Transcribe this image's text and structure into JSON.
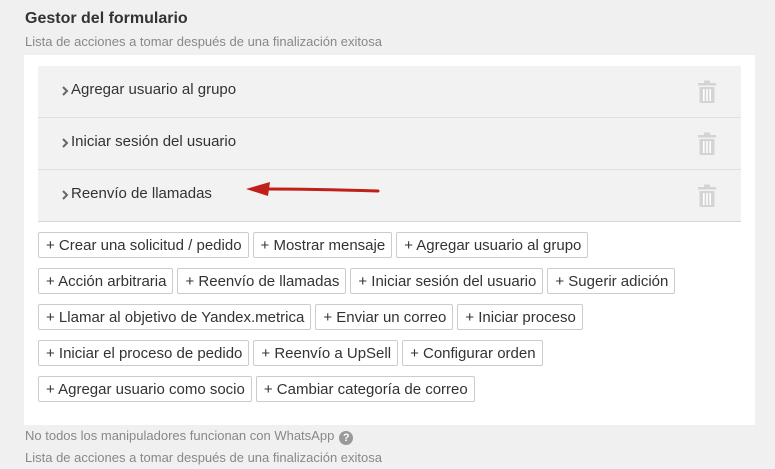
{
  "header": {
    "title": "Gestor del formulario",
    "subtitle": "Lista de acciones a tomar después de una finalización exitosa"
  },
  "handlers": [
    {
      "label": "Agregar usuario al grupo",
      "icon": "chevron-right-icon",
      "delete_icon": "trash-icon"
    },
    {
      "label": "Iniciar sesión del usuario",
      "icon": "chevron-right-icon",
      "delete_icon": "trash-icon"
    },
    {
      "label": "Reenvío de llamadas",
      "icon": "chevron-right-icon",
      "delete_icon": "trash-icon"
    }
  ],
  "actions": [
    [
      "+ Crear una solicitud / pedido",
      "+ Mostrar mensaje",
      "+ Agregar usuario al grupo"
    ],
    [
      "+ Acción arbitraria",
      "+ Reenvío de llamadas",
      "+ Iniciar sesión del usuario",
      "+ Sugerir adición"
    ],
    [
      "+ Llamar al objetivo de Yandex.metrica",
      "+ Enviar un correo",
      "+ Iniciar proceso"
    ],
    [
      "+ Iniciar el proceso de pedido",
      "+ Reenvío a UpSell",
      "+ Configurar orden"
    ],
    [
      "+ Agregar usuario como socio",
      "+ Cambiar categoría de correo"
    ]
  ],
  "footer": {
    "note": "No todos los manipuladores funcionan con WhatsApp",
    "help_icon": "?",
    "subtitle": "Lista de acciones a tomar después de una finalización exitosa"
  },
  "colors": {
    "arrow": "#c0201a",
    "trash": "#d4d4d4"
  }
}
